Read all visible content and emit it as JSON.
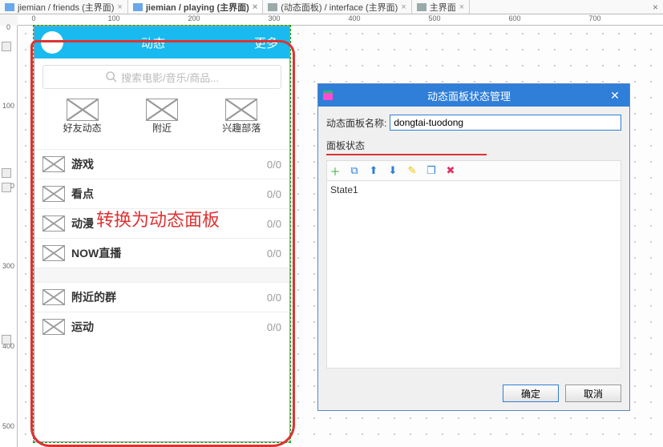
{
  "tabs": [
    {
      "label": "jiemian / friends (主界面)",
      "active": false
    },
    {
      "label": "jiemian / playing (主界面)",
      "active": true
    },
    {
      "label": "(动态面板) / interface (主界面)",
      "active": false
    },
    {
      "label": "主界面",
      "active": false
    }
  ],
  "ruler_h": [
    "0",
    "100",
    "200",
    "300",
    "400",
    "500",
    "600",
    "700"
  ],
  "ruler_v": [
    "0",
    "100",
    "200",
    "300",
    "400",
    "500"
  ],
  "panel": {
    "header": {
      "title": "动态",
      "more": "更多"
    },
    "search_placeholder": "搜索电影/音乐/商品...",
    "icons": [
      {
        "label": "好友动态"
      },
      {
        "label": "附近"
      },
      {
        "label": "兴趣部落"
      }
    ],
    "list": [
      {
        "label": "游戏",
        "count": "0/0"
      },
      {
        "label": "看点",
        "count": "0/0"
      },
      {
        "label": "动漫",
        "count": "0/0"
      },
      {
        "label": "NOW直播",
        "count": "0/0"
      }
    ],
    "list2": [
      {
        "label": "附近的群",
        "count": "0/0"
      },
      {
        "label": "运动",
        "count": "0/0"
      }
    ],
    "annotation": "转换为动态面板"
  },
  "dialog": {
    "title": "动态面板状态管理",
    "name_label": "动态面板名称:",
    "name_value": "dongtai-tuodong",
    "section_label": "面板状态",
    "states": [
      "State1"
    ],
    "ok": "确定",
    "cancel": "取消"
  }
}
